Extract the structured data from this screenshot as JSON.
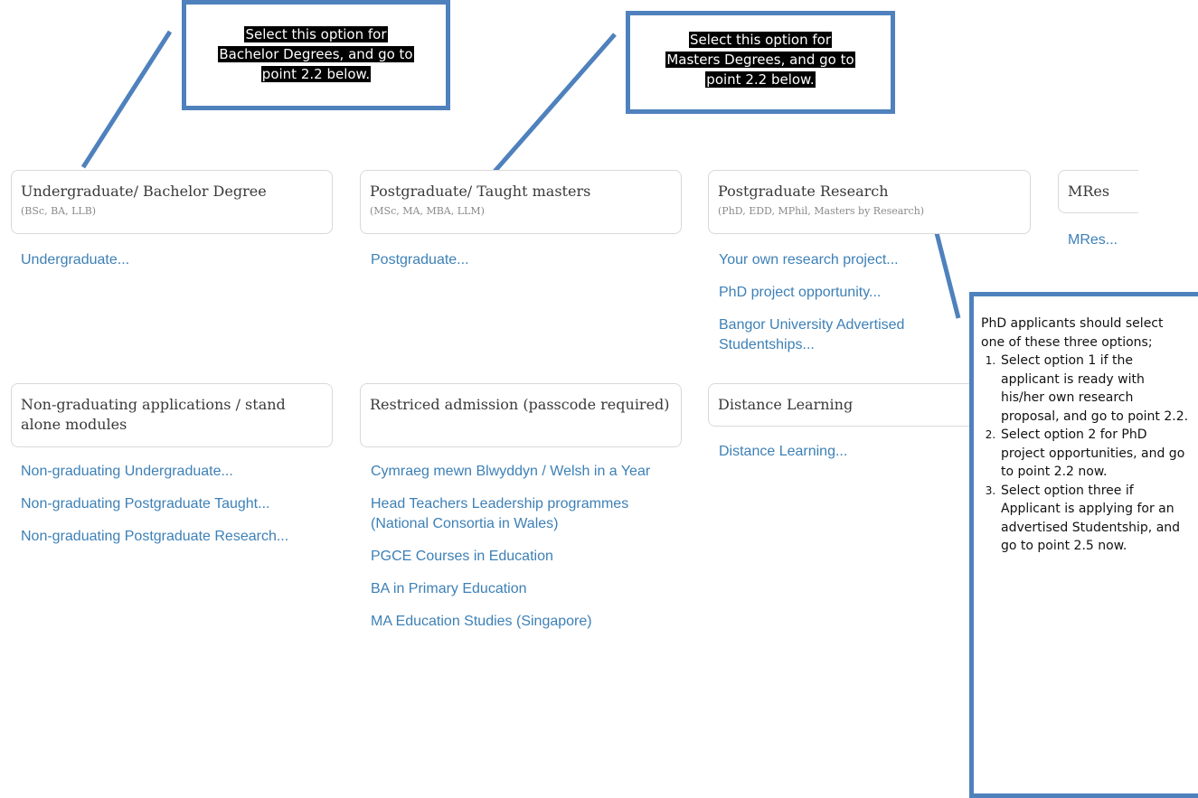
{
  "callouts": {
    "bachelor": {
      "line1": "Select this option for",
      "line2": "Bachelor Degrees, and go to",
      "line3": "point 2.2 below."
    },
    "masters": {
      "line1": "Select this option for",
      "line2": "Masters Degrees, and go to",
      "line3": "point 2.2 below."
    }
  },
  "cards": {
    "undergraduate": {
      "title": "Undergraduate/ Bachelor Degree",
      "subtitle": "(BSc, BA, LLB)",
      "links": [
        "Undergraduate..."
      ]
    },
    "postgraduate": {
      "title": "Postgraduate/ Taught masters",
      "subtitle": "(MSc, MA, MBA, LLM)",
      "links": [
        "Postgraduate..."
      ]
    },
    "research": {
      "title": "Postgraduate Research",
      "subtitle": "(PhD, EDD, MPhil, Masters by Research)",
      "links": [
        "Your own research project...",
        "PhD project opportunity...",
        "Bangor University Advertised Studentships..."
      ]
    },
    "mres": {
      "title": "MRes",
      "links": [
        "MRes..."
      ]
    },
    "nongraduating": {
      "title": "Non-graduating applications / stand alone modules",
      "links": [
        "Non-graduating Undergraduate...",
        "Non-graduating Postgraduate Taught...",
        "Non-graduating Postgraduate Research..."
      ]
    },
    "restricted": {
      "title": "Restriced admission (passcode required)",
      "links": [
        "Cymraeg mewn Blwyddyn / Welsh in a Year",
        "Head Teachers Leadership programmes (National Consortia in Wales)",
        "PGCE Courses in Education",
        "BA in Primary Education",
        "MA Education Studies (Singapore)"
      ]
    },
    "distance": {
      "title": "Distance Learning",
      "links": [
        "Distance Learning..."
      ]
    }
  },
  "note": {
    "intro": "PhD applicants should select one of these three options;",
    "items": [
      "Select option 1 if the applicant is ready with his/her own research proposal, and go to point 2.2.",
      "Select option 2 for PhD project opportunities, and go to point 2.2 now.",
      "Select option three if Applicant is applying for an advertised Studentship, and go to point 2.5 now."
    ]
  },
  "colors": {
    "link": "#3d80b6",
    "callout_border": "#4f81bd"
  }
}
